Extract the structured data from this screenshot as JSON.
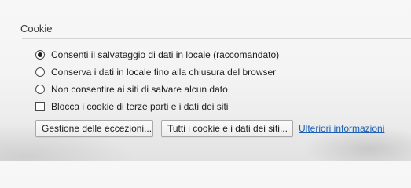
{
  "section": {
    "title": "Cookie"
  },
  "options": [
    {
      "type": "radio",
      "checked": true,
      "label": "Consenti il salvataggio di dati in locale (raccomandato)"
    },
    {
      "type": "radio",
      "checked": false,
      "label": "Conserva i dati in locale fino alla chiusura del browser"
    },
    {
      "type": "radio",
      "checked": false,
      "label": "Non consentire ai siti di salvare alcun dato"
    },
    {
      "type": "checkbox",
      "checked": false,
      "label": "Blocca i cookie di terze parti e i dati dei siti"
    }
  ],
  "buttons": {
    "exceptions_label": "Gestione delle eccezioni...",
    "all_cookies_label": "Tutti i cookie e i dati dei siti..."
  },
  "link": {
    "more_info_label": "Ulteriori informazioni"
  },
  "colors": {
    "link": "#1a5fb4",
    "text": "#202020"
  }
}
